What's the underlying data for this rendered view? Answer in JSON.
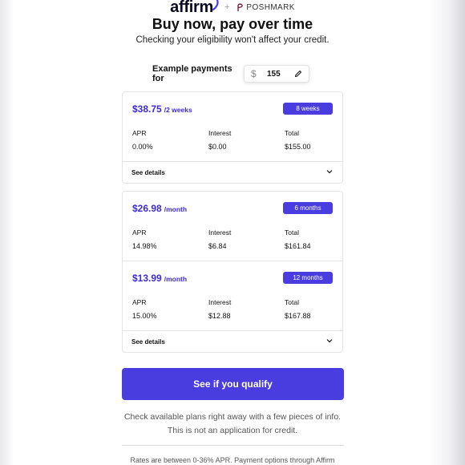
{
  "header": {
    "affirm_logo": "affirm",
    "plus": "+",
    "poshmark_logo": "POSHMARK",
    "title": "Buy now, pay over time",
    "subtitle": "Checking your eligibility won't affect your credit."
  },
  "example": {
    "label": "Example payments for",
    "currency": "$",
    "amount": "155",
    "edit_icon": "pencil-icon"
  },
  "plans": [
    {
      "price": "$38.75",
      "period": "/2 weeks",
      "badge": "8 weeks",
      "apr_label": "APR",
      "apr": "0.00%",
      "interest_label": "Interest",
      "interest": "$0.00",
      "total_label": "Total",
      "total": "$155.00"
    },
    {
      "price": "$26.98",
      "period": "/month",
      "badge": "6 months",
      "apr_label": "APR",
      "apr": "14.98%",
      "interest_label": "Interest",
      "interest": "$6.84",
      "total_label": "Total",
      "total": "$161.84"
    },
    {
      "price": "$13.99",
      "period": "/month",
      "badge": "12 months",
      "apr_label": "APR",
      "apr": "15.00%",
      "interest_label": "Interest",
      "interest": "$12.88",
      "total_label": "Total",
      "total": "$167.88"
    }
  ],
  "see_details": "See details",
  "cta": "See if you qualify",
  "info_line1": "Check available plans right away with a few pieces of info.",
  "info_line2": "This is not an application for credit.",
  "footer": "Rates are between 0-36% APR. Payment options through Affirm",
  "colors": {
    "accent": "#4a3de0",
    "price_text": "#3d2bd6"
  }
}
